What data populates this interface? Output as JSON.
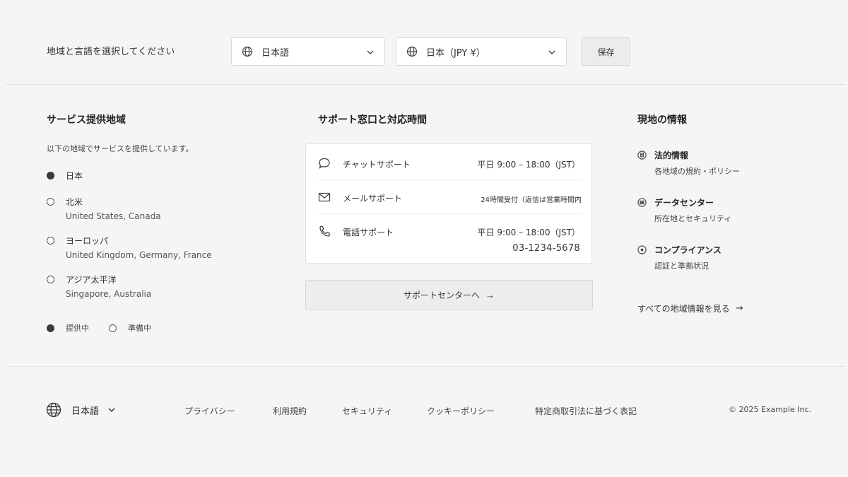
{
  "selector": {
    "prompt": "地域と言語を選択してください",
    "language": {
      "value": "日本語",
      "icon": "globe-icon"
    },
    "region": {
      "value": "日本（JPY ¥）",
      "icon": "globe-icon"
    },
    "save_label": "保存"
  },
  "service_areas": {
    "title": "サービス提供地域",
    "description": "以下の地域でサービスを提供しています。",
    "items": [
      {
        "name": "日本",
        "countries": "",
        "status": "active"
      },
      {
        "name": "北米",
        "countries": "United States, Canada",
        "status": "preparing"
      },
      {
        "name": "ヨーロッパ",
        "countries": "United Kingdom, Germany, France",
        "status": "preparing"
      },
      {
        "name": "アジア太平洋",
        "countries": "Singapore, Australia",
        "status": "preparing"
      }
    ],
    "legend": {
      "active": "提供中",
      "preparing": "準備中"
    }
  },
  "support": {
    "title": "サポート窓口と対応時間",
    "channels": [
      {
        "label": "チャットサポート",
        "hours": "平日 9:00 – 18:00（JST）",
        "icon": "chat-bubble-icon"
      },
      {
        "label": "メールサポート",
        "hours": "24時間受付（返信は営業時間内",
        "icon": "mail-icon"
      },
      {
        "label": "電話サポート",
        "hours": "平日 9:00 – 18:00（JST）",
        "phone": "03-1234-5678",
        "icon": "phone-icon"
      }
    ],
    "center_button": "サポートセンターへ",
    "arrow": "→"
  },
  "local_info": {
    "title": "現地の情報",
    "items": [
      {
        "name": "法的情報",
        "sub": "各地域の規約・ポリシー",
        "icon": "legal-icon"
      },
      {
        "name": "データセンター",
        "sub": "所在地とセキュリティ",
        "icon": "data-center-icon"
      },
      {
        "name": "コンプライアンス",
        "sub": "認証と準拠状況",
        "icon": "compliance-icon"
      }
    ],
    "all_link": "すべての地域情報を見る",
    "arrow": "→"
  },
  "footer": {
    "language": "日本語",
    "links": [
      "プライバシー",
      "利用規約",
      "セキュリティ",
      "クッキーポリシー",
      "特定商取引法に基づく表記"
    ],
    "copyright": "© 2025 Example Inc."
  }
}
